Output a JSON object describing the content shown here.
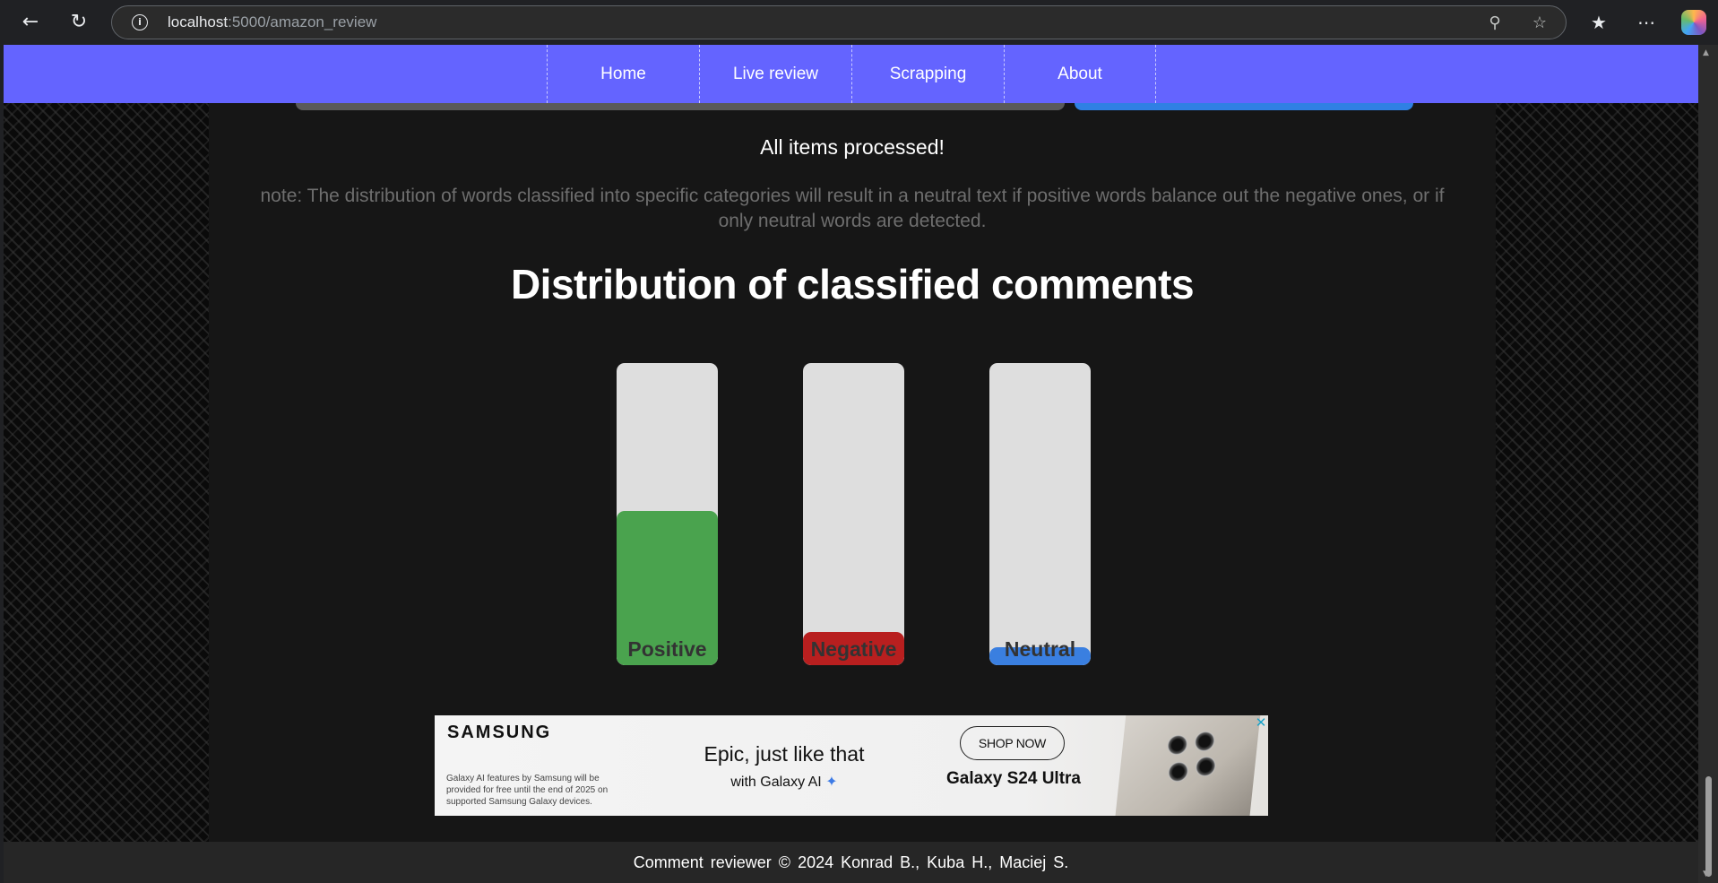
{
  "browser": {
    "back_icon": "arrow-left-icon",
    "reload_icon": "reload-icon",
    "url_host": "localhost",
    "url_rest": ":5000/amazon_review",
    "zoom_icon": "zoom-out-icon",
    "favorite_icon": "star-icon",
    "favorites_list_icon": "favorites-icon",
    "menu_icon": "more-icon"
  },
  "nav": {
    "items": [
      {
        "label": "Home"
      },
      {
        "label": "Live review"
      },
      {
        "label": "Scrapping"
      },
      {
        "label": "About"
      }
    ],
    "color": "#6464ff"
  },
  "main": {
    "status": "All items processed!",
    "note": "note: The distribution of words classified into specific categories will result in a neutral text if positive words balance out the negative ones, or if only neutral words are detected."
  },
  "chart_data": {
    "type": "bar",
    "title": "Distribution of classified comments",
    "categories": [
      "Positive",
      "Negative",
      "Neutral"
    ],
    "values": [
      0.51,
      0.11,
      0.06
    ],
    "ylim": [
      0,
      1
    ],
    "colors": [
      "#4aa34e",
      "#b81f1f",
      "#3a7fe0"
    ],
    "track_color": "#dedede"
  },
  "ad": {
    "brand": "SAMSUNG",
    "fine_print": "Galaxy AI features by Samsung will be provided for free until the end of 2025 on supported Samsung Galaxy devices.",
    "headline": "Epic, just like that",
    "sub": "with Galaxy AI",
    "cta": "SHOP NOW",
    "product": "Galaxy S24 Ultra",
    "close": "✕"
  },
  "footer": {
    "text": "Comment reviewer © 2024 Konrad B., Kuba H., Maciej S."
  }
}
